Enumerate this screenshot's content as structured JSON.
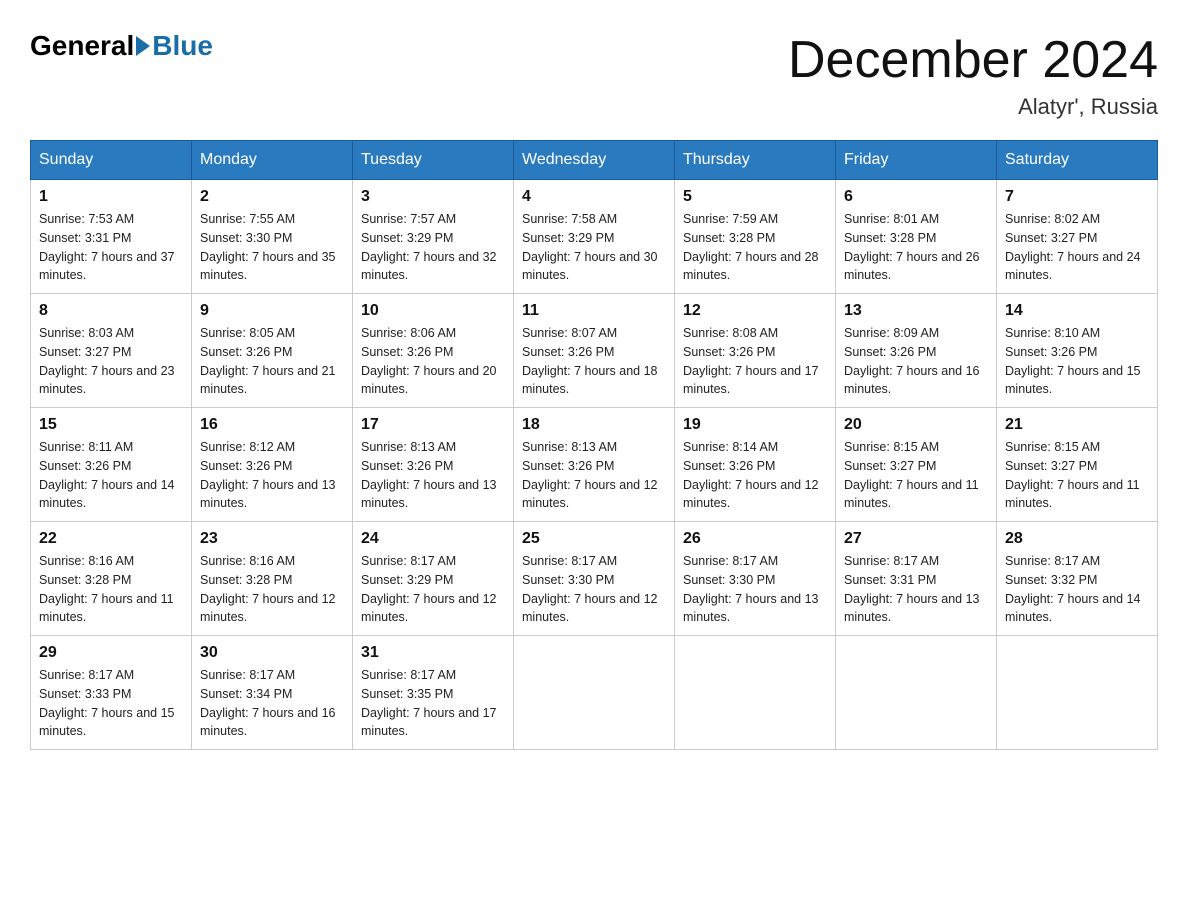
{
  "header": {
    "logo_general": "General",
    "logo_blue": "Blue",
    "month_title": "December 2024",
    "location": "Alatyr', Russia"
  },
  "weekdays": [
    "Sunday",
    "Monday",
    "Tuesday",
    "Wednesday",
    "Thursday",
    "Friday",
    "Saturday"
  ],
  "weeks": [
    [
      {
        "day": "1",
        "sunrise": "Sunrise: 7:53 AM",
        "sunset": "Sunset: 3:31 PM",
        "daylight": "Daylight: 7 hours and 37 minutes."
      },
      {
        "day": "2",
        "sunrise": "Sunrise: 7:55 AM",
        "sunset": "Sunset: 3:30 PM",
        "daylight": "Daylight: 7 hours and 35 minutes."
      },
      {
        "day": "3",
        "sunrise": "Sunrise: 7:57 AM",
        "sunset": "Sunset: 3:29 PM",
        "daylight": "Daylight: 7 hours and 32 minutes."
      },
      {
        "day": "4",
        "sunrise": "Sunrise: 7:58 AM",
        "sunset": "Sunset: 3:29 PM",
        "daylight": "Daylight: 7 hours and 30 minutes."
      },
      {
        "day": "5",
        "sunrise": "Sunrise: 7:59 AM",
        "sunset": "Sunset: 3:28 PM",
        "daylight": "Daylight: 7 hours and 28 minutes."
      },
      {
        "day": "6",
        "sunrise": "Sunrise: 8:01 AM",
        "sunset": "Sunset: 3:28 PM",
        "daylight": "Daylight: 7 hours and 26 minutes."
      },
      {
        "day": "7",
        "sunrise": "Sunrise: 8:02 AM",
        "sunset": "Sunset: 3:27 PM",
        "daylight": "Daylight: 7 hours and 24 minutes."
      }
    ],
    [
      {
        "day": "8",
        "sunrise": "Sunrise: 8:03 AM",
        "sunset": "Sunset: 3:27 PM",
        "daylight": "Daylight: 7 hours and 23 minutes."
      },
      {
        "day": "9",
        "sunrise": "Sunrise: 8:05 AM",
        "sunset": "Sunset: 3:26 PM",
        "daylight": "Daylight: 7 hours and 21 minutes."
      },
      {
        "day": "10",
        "sunrise": "Sunrise: 8:06 AM",
        "sunset": "Sunset: 3:26 PM",
        "daylight": "Daylight: 7 hours and 20 minutes."
      },
      {
        "day": "11",
        "sunrise": "Sunrise: 8:07 AM",
        "sunset": "Sunset: 3:26 PM",
        "daylight": "Daylight: 7 hours and 18 minutes."
      },
      {
        "day": "12",
        "sunrise": "Sunrise: 8:08 AM",
        "sunset": "Sunset: 3:26 PM",
        "daylight": "Daylight: 7 hours and 17 minutes."
      },
      {
        "day": "13",
        "sunrise": "Sunrise: 8:09 AM",
        "sunset": "Sunset: 3:26 PM",
        "daylight": "Daylight: 7 hours and 16 minutes."
      },
      {
        "day": "14",
        "sunrise": "Sunrise: 8:10 AM",
        "sunset": "Sunset: 3:26 PM",
        "daylight": "Daylight: 7 hours and 15 minutes."
      }
    ],
    [
      {
        "day": "15",
        "sunrise": "Sunrise: 8:11 AM",
        "sunset": "Sunset: 3:26 PM",
        "daylight": "Daylight: 7 hours and 14 minutes."
      },
      {
        "day": "16",
        "sunrise": "Sunrise: 8:12 AM",
        "sunset": "Sunset: 3:26 PM",
        "daylight": "Daylight: 7 hours and 13 minutes."
      },
      {
        "day": "17",
        "sunrise": "Sunrise: 8:13 AM",
        "sunset": "Sunset: 3:26 PM",
        "daylight": "Daylight: 7 hours and 13 minutes."
      },
      {
        "day": "18",
        "sunrise": "Sunrise: 8:13 AM",
        "sunset": "Sunset: 3:26 PM",
        "daylight": "Daylight: 7 hours and 12 minutes."
      },
      {
        "day": "19",
        "sunrise": "Sunrise: 8:14 AM",
        "sunset": "Sunset: 3:26 PM",
        "daylight": "Daylight: 7 hours and 12 minutes."
      },
      {
        "day": "20",
        "sunrise": "Sunrise: 8:15 AM",
        "sunset": "Sunset: 3:27 PM",
        "daylight": "Daylight: 7 hours and 11 minutes."
      },
      {
        "day": "21",
        "sunrise": "Sunrise: 8:15 AM",
        "sunset": "Sunset: 3:27 PM",
        "daylight": "Daylight: 7 hours and 11 minutes."
      }
    ],
    [
      {
        "day": "22",
        "sunrise": "Sunrise: 8:16 AM",
        "sunset": "Sunset: 3:28 PM",
        "daylight": "Daylight: 7 hours and 11 minutes."
      },
      {
        "day": "23",
        "sunrise": "Sunrise: 8:16 AM",
        "sunset": "Sunset: 3:28 PM",
        "daylight": "Daylight: 7 hours and 12 minutes."
      },
      {
        "day": "24",
        "sunrise": "Sunrise: 8:17 AM",
        "sunset": "Sunset: 3:29 PM",
        "daylight": "Daylight: 7 hours and 12 minutes."
      },
      {
        "day": "25",
        "sunrise": "Sunrise: 8:17 AM",
        "sunset": "Sunset: 3:30 PM",
        "daylight": "Daylight: 7 hours and 12 minutes."
      },
      {
        "day": "26",
        "sunrise": "Sunrise: 8:17 AM",
        "sunset": "Sunset: 3:30 PM",
        "daylight": "Daylight: 7 hours and 13 minutes."
      },
      {
        "day": "27",
        "sunrise": "Sunrise: 8:17 AM",
        "sunset": "Sunset: 3:31 PM",
        "daylight": "Daylight: 7 hours and 13 minutes."
      },
      {
        "day": "28",
        "sunrise": "Sunrise: 8:17 AM",
        "sunset": "Sunset: 3:32 PM",
        "daylight": "Daylight: 7 hours and 14 minutes."
      }
    ],
    [
      {
        "day": "29",
        "sunrise": "Sunrise: 8:17 AM",
        "sunset": "Sunset: 3:33 PM",
        "daylight": "Daylight: 7 hours and 15 minutes."
      },
      {
        "day": "30",
        "sunrise": "Sunrise: 8:17 AM",
        "sunset": "Sunset: 3:34 PM",
        "daylight": "Daylight: 7 hours and 16 minutes."
      },
      {
        "day": "31",
        "sunrise": "Sunrise: 8:17 AM",
        "sunset": "Sunset: 3:35 PM",
        "daylight": "Daylight: 7 hours and 17 minutes."
      },
      null,
      null,
      null,
      null
    ]
  ]
}
